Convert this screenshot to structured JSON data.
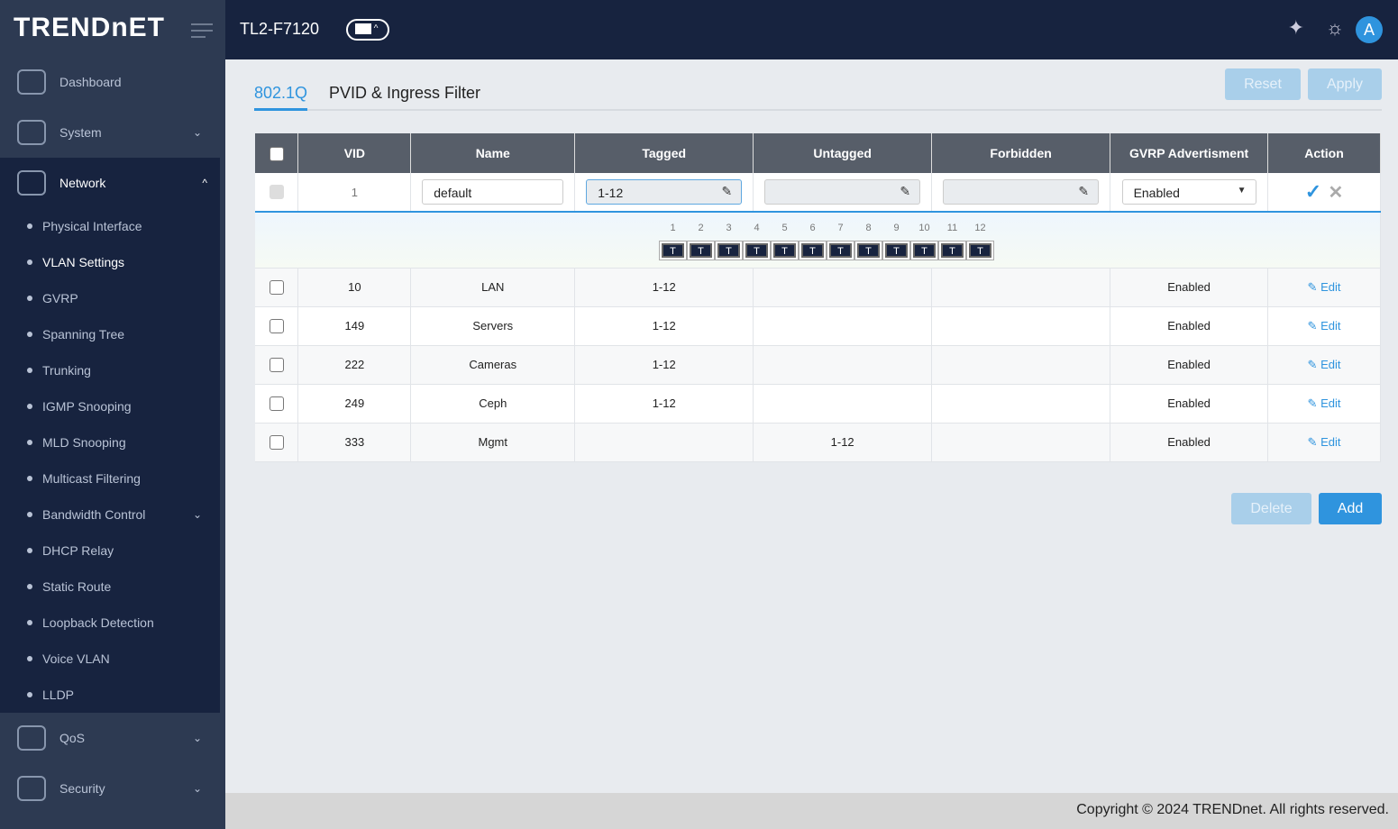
{
  "brand": "TRENDnET",
  "header": {
    "device": "TL2-F7120",
    "avatar": "A"
  },
  "sidebar": {
    "dashboard": "Dashboard",
    "system": "System",
    "network": "Network",
    "qos": "QoS",
    "security": "Security",
    "network_items": [
      "Physical Interface",
      "VLAN Settings",
      "GVRP",
      "Spanning Tree",
      "Trunking",
      "IGMP Snooping",
      "MLD Snooping",
      "Multicast Filtering",
      "Bandwidth Control",
      "DHCP Relay",
      "Static Route",
      "Loopback Detection",
      "Voice VLAN",
      "LLDP"
    ]
  },
  "tabs": [
    "802.1Q",
    "PVID & Ingress Filter"
  ],
  "buttons": {
    "reset": "Reset",
    "apply": "Apply",
    "delete": "Delete",
    "add": "Add"
  },
  "table": {
    "headers": [
      "VID",
      "Name",
      "Tagged",
      "Untagged",
      "Forbidden",
      "GVRP Advertisment",
      "Action"
    ],
    "edit_row": {
      "vid": "1",
      "name": "default",
      "tagged": "1-12",
      "untagged": "",
      "forbidden": "",
      "gvrp": "Enabled"
    },
    "ports": [
      "1",
      "2",
      "3",
      "4",
      "5",
      "6",
      "7",
      "8",
      "9",
      "10",
      "11",
      "12"
    ],
    "port_mode": "T",
    "rows": [
      {
        "vid": "10",
        "name": "LAN",
        "tagged": "1-12",
        "untagged": "",
        "forbidden": "",
        "gvrp": "Enabled",
        "action": "Edit"
      },
      {
        "vid": "149",
        "name": "Servers",
        "tagged": "1-12",
        "untagged": "",
        "forbidden": "",
        "gvrp": "Enabled",
        "action": "Edit"
      },
      {
        "vid": "222",
        "name": "Cameras",
        "tagged": "1-12",
        "untagged": "",
        "forbidden": "",
        "gvrp": "Enabled",
        "action": "Edit"
      },
      {
        "vid": "249",
        "name": "Ceph",
        "tagged": "1-12",
        "untagged": "",
        "forbidden": "",
        "gvrp": "Enabled",
        "action": "Edit"
      },
      {
        "vid": "333",
        "name": "Mgmt",
        "tagged": "",
        "untagged": "1-12",
        "forbidden": "",
        "gvrp": "Enabled",
        "action": "Edit"
      }
    ]
  },
  "footer": "Copyright © 2024 TRENDnet. All rights reserved."
}
